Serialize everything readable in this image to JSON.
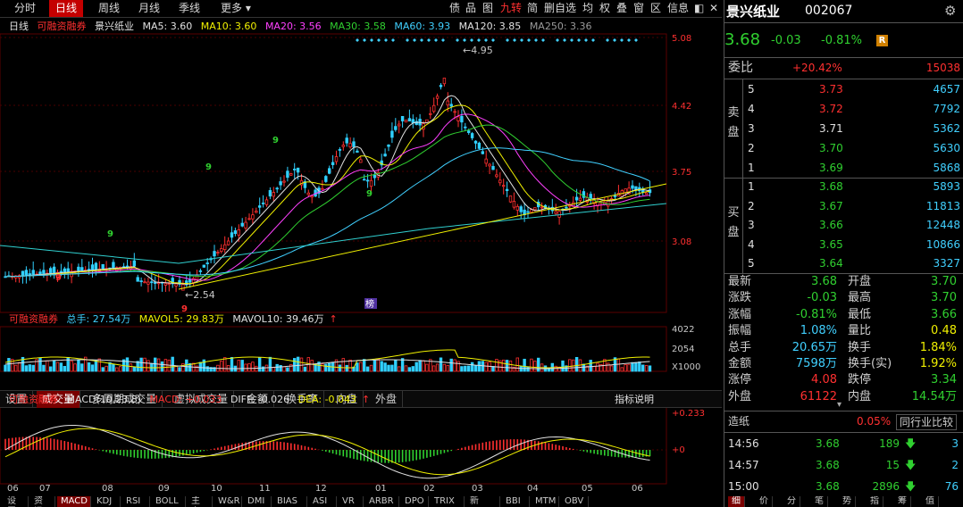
{
  "top_tabs": [
    "分时",
    "日线",
    "周线",
    "月线",
    "季线",
    "更多"
  ],
  "tools": [
    "债",
    "品",
    "图",
    "九转",
    "简",
    "删自选",
    "均",
    "权",
    "叠",
    "窗",
    "区",
    "信息"
  ],
  "legend": {
    "period": "日线",
    "margin": "可融资融券",
    "name": "景兴纸业",
    "ma5": "MA5: 3.60",
    "ma10": "MA10: 3.60",
    "ma20": "MA20: 3.56",
    "ma30": "MA30: 3.58",
    "ma60": "MA60: 3.93",
    "ma120": "MA120: 3.85",
    "ma250": "MA250: 3.36"
  },
  "price_axis": [
    "5.08",
    "4.42",
    "3.75",
    "3.08"
  ],
  "price_annotations": {
    "high": "4.95",
    "low": "2.54",
    "bang": "榜"
  },
  "volume_legend": {
    "margin": "可融资融券",
    "total": "总手: 27.54万",
    "mavol5": "MAVOL5: 29.83万",
    "mavol10": "MAVOL10: 39.46万"
  },
  "volume_axis": [
    "4022",
    "2054",
    "X1000"
  ],
  "sub_tabs": [
    "设置",
    "成交量",
    "多周期成交量",
    "虚拟成交量",
    "金额",
    "换手率",
    "内盘",
    "外盘"
  ],
  "macd_legend": {
    "margin": "可融资融券",
    "macd": "MACD(10,23,8)",
    "macd_val": "MACD: +0.033",
    "diff": "DIFF: -0.026",
    "dea": "DEA: -0.043",
    "explain": "指标说明"
  },
  "macd_axis": [
    "+0.233",
    "+0"
  ],
  "x_labels": [
    "06",
    "07",
    "08",
    "09",
    "10",
    "11",
    "12",
    "01",
    "02",
    "03",
    "04",
    "05",
    "06"
  ],
  "bottom_tabs": [
    "设置",
    "资讯",
    "MACD",
    "KDJ",
    "RSI",
    "BOLL",
    "主力",
    "W&R",
    "DMI",
    "BIAS",
    "ASI",
    "VR",
    "ARBR",
    "DPO",
    "TRIX",
    "新DMA",
    "BBI",
    "MTM",
    "OBV"
  ],
  "stock": {
    "name": "景兴纸业",
    "code": "002067",
    "price": "3.68",
    "change": "-0.03",
    "change_pct": "-0.81%",
    "r_badge": "R"
  },
  "order_ratio": {
    "label": "委比",
    "pct": "+20.42%",
    "diff": "15038"
  },
  "sell_label": [
    "卖",
    "盘"
  ],
  "buy_label": [
    "买",
    "盘"
  ],
  "asks": [
    {
      "level": "5",
      "price": "3.73",
      "vol": "4657",
      "color": "#ff3030"
    },
    {
      "level": "4",
      "price": "3.72",
      "vol": "7792",
      "color": "#ff3030"
    },
    {
      "level": "3",
      "price": "3.71",
      "vol": "5362",
      "color": "#e0e0e0"
    },
    {
      "level": "2",
      "price": "3.70",
      "vol": "5630",
      "color": "#30d030"
    },
    {
      "level": "1",
      "price": "3.69",
      "vol": "5868",
      "color": "#30d030"
    }
  ],
  "bids": [
    {
      "level": "1",
      "price": "3.68",
      "vol": "5893",
      "color": "#30d030"
    },
    {
      "level": "2",
      "price": "3.67",
      "vol": "11813",
      "color": "#30d030"
    },
    {
      "level": "3",
      "price": "3.66",
      "vol": "12448",
      "color": "#30d030"
    },
    {
      "level": "4",
      "price": "3.65",
      "vol": "10866",
      "color": "#30d030"
    },
    {
      "level": "5",
      "price": "3.64",
      "vol": "3327",
      "color": "#30d030"
    }
  ],
  "stats": [
    {
      "l1": "最新",
      "v1": "3.68",
      "c1": "#30d030",
      "l2": "开盘",
      "v2": "3.70",
      "c2": "#30d030"
    },
    {
      "l1": "涨跌",
      "v1": "-0.03",
      "c1": "#30d030",
      "l2": "最高",
      "v2": "3.70",
      "c2": "#30d030"
    },
    {
      "l1": "涨幅",
      "v1": "-0.81%",
      "c1": "#30d030",
      "l2": "最低",
      "v2": "3.66",
      "c2": "#30d030"
    },
    {
      "l1": "振幅",
      "v1": "1.08%",
      "c1": "#40d0ff",
      "l2": "量比",
      "v2": "0.48",
      "c2": "#f0f000"
    },
    {
      "l1": "总手",
      "v1": "20.65万",
      "c1": "#40d0ff",
      "l2": "换手",
      "v2": "1.84%",
      "c2": "#f0f000"
    },
    {
      "l1": "金额",
      "v1": "7598万",
      "c1": "#40d0ff",
      "l2": "换手(实)",
      "v2": "1.92%",
      "c2": "#f0f000"
    },
    {
      "l1": "涨停",
      "v1": "4.08",
      "c1": "#ff3030",
      "l2": "跌停",
      "v2": "3.34",
      "c2": "#30d030"
    },
    {
      "l1": "外盘",
      "v1": "61122",
      "c1": "#ff3030",
      "l2": "内盘",
      "v2": "14.54万",
      "c2": "#30d030"
    }
  ],
  "industry": {
    "name": "造纸",
    "pct": "0.05%",
    "compare": "同行业比较"
  },
  "ticks": [
    {
      "time": "14:56",
      "price": "3.68",
      "vol": "189",
      "count": "3"
    },
    {
      "time": "14:57",
      "price": "3.68",
      "vol": "15",
      "count": "2"
    },
    {
      "time": "15:00",
      "price": "3.68",
      "vol": "2896",
      "count": "76"
    }
  ],
  "rp_bottom_tabs": [
    "细",
    "价",
    "分",
    "笔",
    "势",
    "指",
    "筹",
    "值"
  ],
  "colors": {
    "up": "#ff3030",
    "down": "#30d030",
    "accent": "#c40000"
  }
}
